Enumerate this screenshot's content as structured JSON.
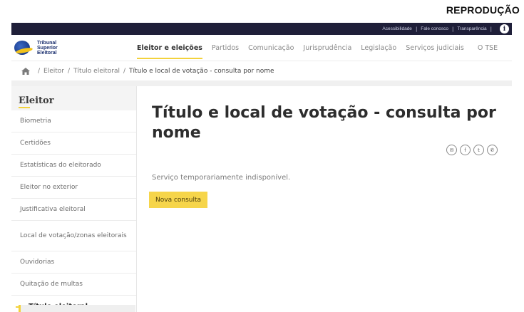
{
  "caption": "REPRODUÇÃO",
  "utility": {
    "links": [
      "Acessibilidade",
      "Fale conosco",
      "Transparência"
    ],
    "separator": "|",
    "info_glyph": "i"
  },
  "logo": {
    "line1": "Tribunal",
    "line2": "Superior",
    "line3": "Eleitoral"
  },
  "nav": {
    "items": [
      {
        "label": "Eleitor e eleições",
        "active": true
      },
      {
        "label": "Partidos"
      },
      {
        "label": "Comunicação"
      },
      {
        "label": "Jurisprudência"
      },
      {
        "label": "Legislação"
      },
      {
        "label": "Serviços judiciais"
      },
      {
        "label": "O TSE"
      }
    ]
  },
  "breadcrumb": {
    "items": [
      "Eleitor",
      "Título eleitoral",
      "Título e local de votação - consulta por nome"
    ],
    "separator": "/"
  },
  "sidebar": {
    "title": "Eleitor",
    "items": [
      "Biometria",
      "Certidões",
      "Estatísticas do eleitorado",
      "Eleitor no exterior",
      "Justificativa eleitoral",
      "Local de votação/zonas eleitorais",
      "Ouvidorias",
      "Quitação de multas"
    ],
    "selected": "Título eleitoral"
  },
  "main": {
    "title": "Título e local de votação - consulta por nome",
    "status": "Serviço temporariamente indisponível.",
    "button": "Nova consulta",
    "share_icons": [
      "email-icon",
      "facebook-icon",
      "twitter-icon",
      "whatsapp-icon"
    ],
    "share_glyphs": {
      "email": "✉",
      "facebook": "f",
      "twitter": "t",
      "whatsapp": "✆"
    }
  },
  "colors": {
    "utility_bar": "#1f1f39",
    "accent_yellow": "#f3d23c",
    "button_bg": "#f6d54a",
    "band_gray": "#f0f0f0"
  }
}
